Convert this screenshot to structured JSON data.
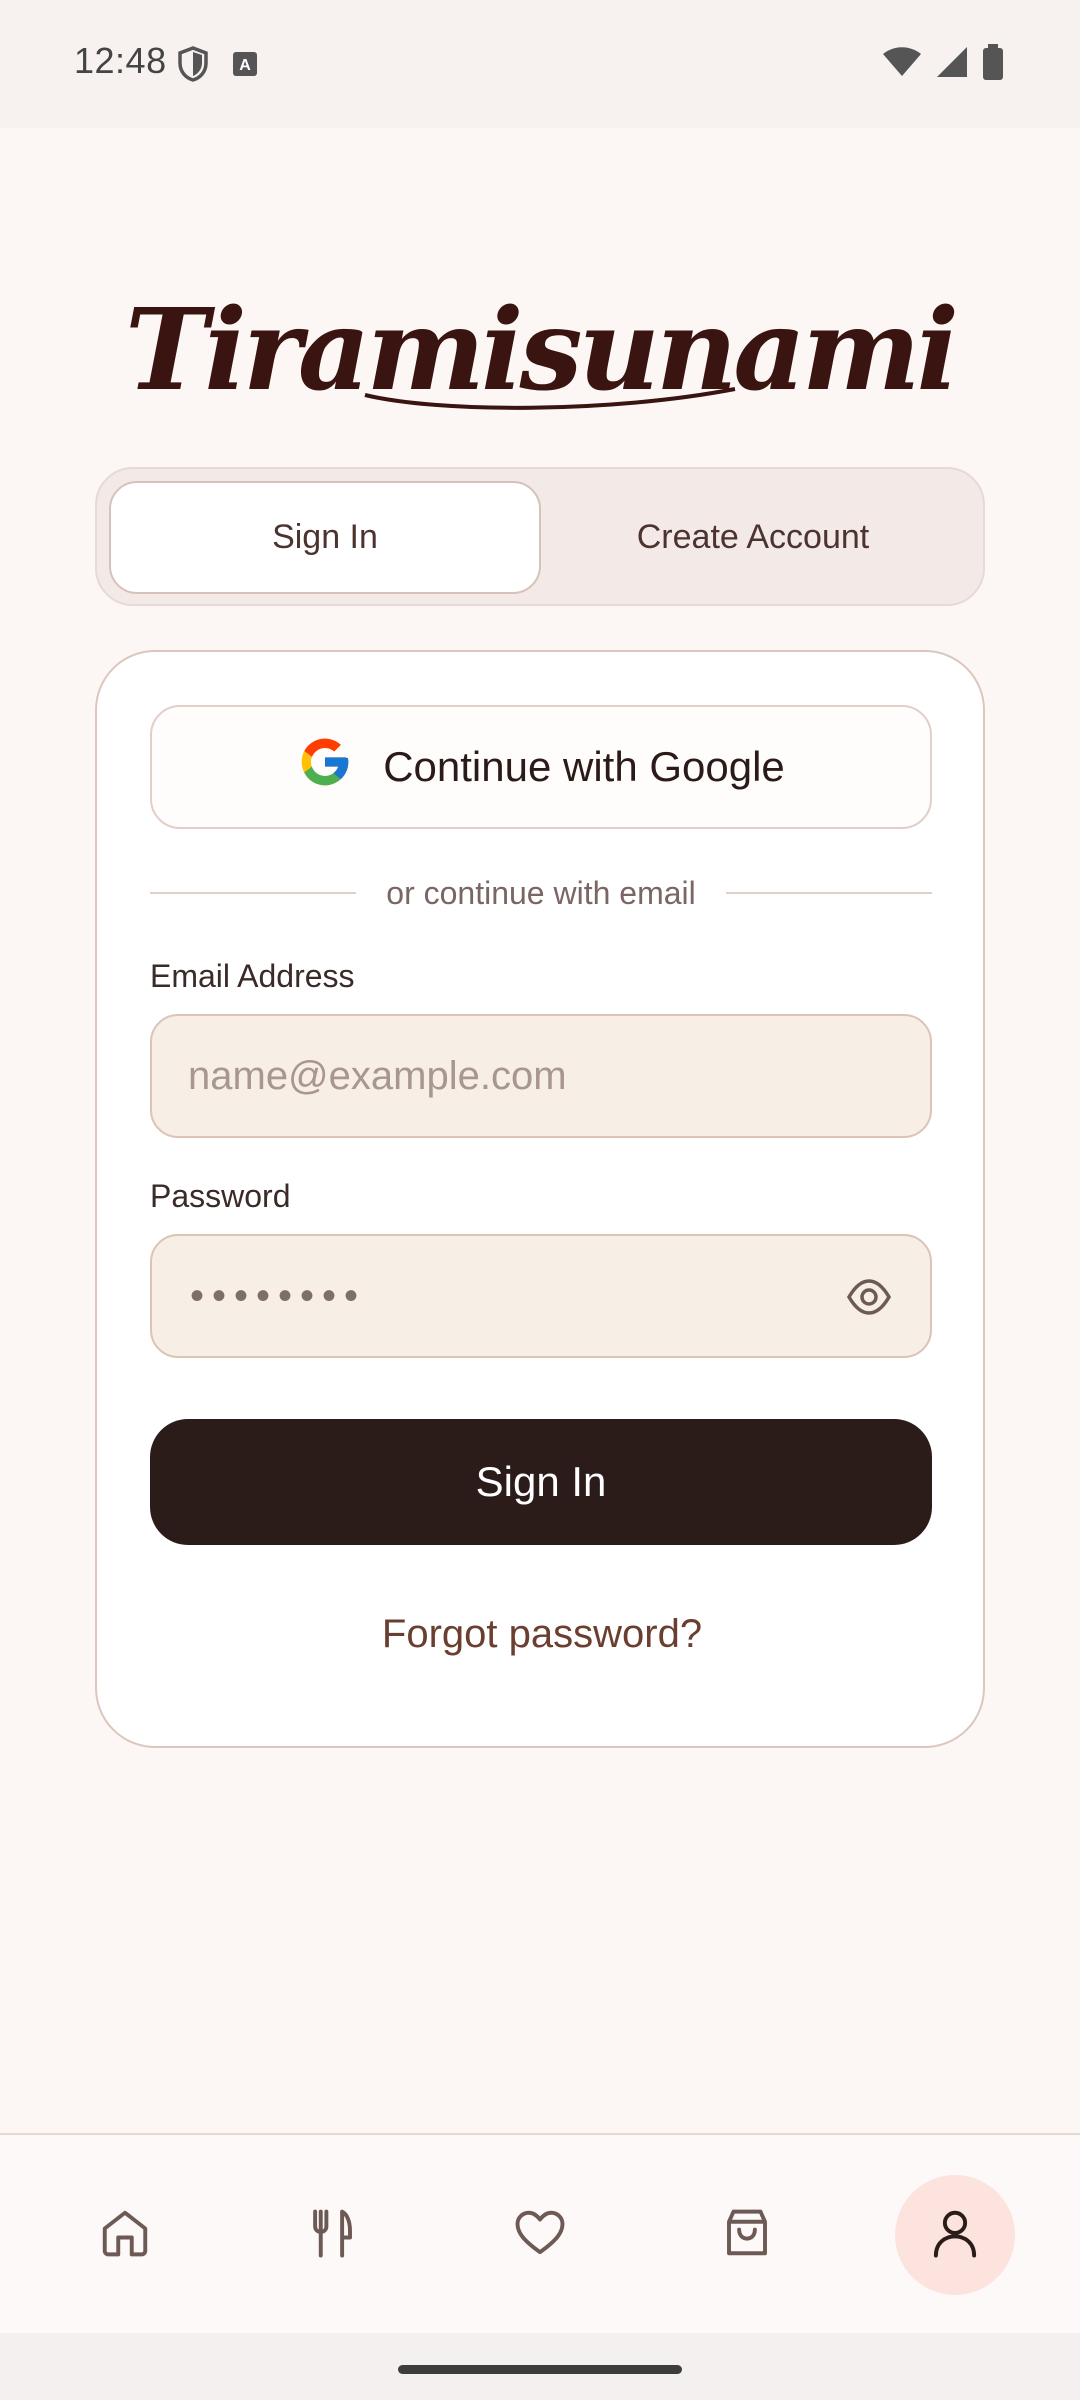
{
  "status_bar": {
    "time": "12:48",
    "icons": [
      "shield-icon",
      "keyboard-icon",
      "wifi-icon",
      "signal-icon",
      "battery-icon"
    ]
  },
  "brand": {
    "logo_text": "Tiramisunami"
  },
  "auth_tabs": {
    "sign_in": "Sign In",
    "create_account": "Create Account",
    "selected": "sign_in"
  },
  "form": {
    "google_button": "Continue with Google",
    "divider_text": "or continue with email",
    "email_label": "Email Address",
    "email_placeholder": "name@example.com",
    "email_value": "",
    "password_label": "Password",
    "password_masked": "••••••••",
    "submit_label": "Sign In",
    "forgot_label": "Forgot password?"
  },
  "bottom_nav": {
    "items": [
      "home-icon",
      "utensils-icon",
      "heart-icon",
      "shopping-bag-icon",
      "user-icon"
    ],
    "active": "user-icon"
  },
  "colors": {
    "background": "#fcf7f5",
    "primary_dark": "#2b1c1a",
    "input_fill": "#f7efe6",
    "accent_link": "#6b3f30",
    "active_nav": "#fde3dd"
  }
}
